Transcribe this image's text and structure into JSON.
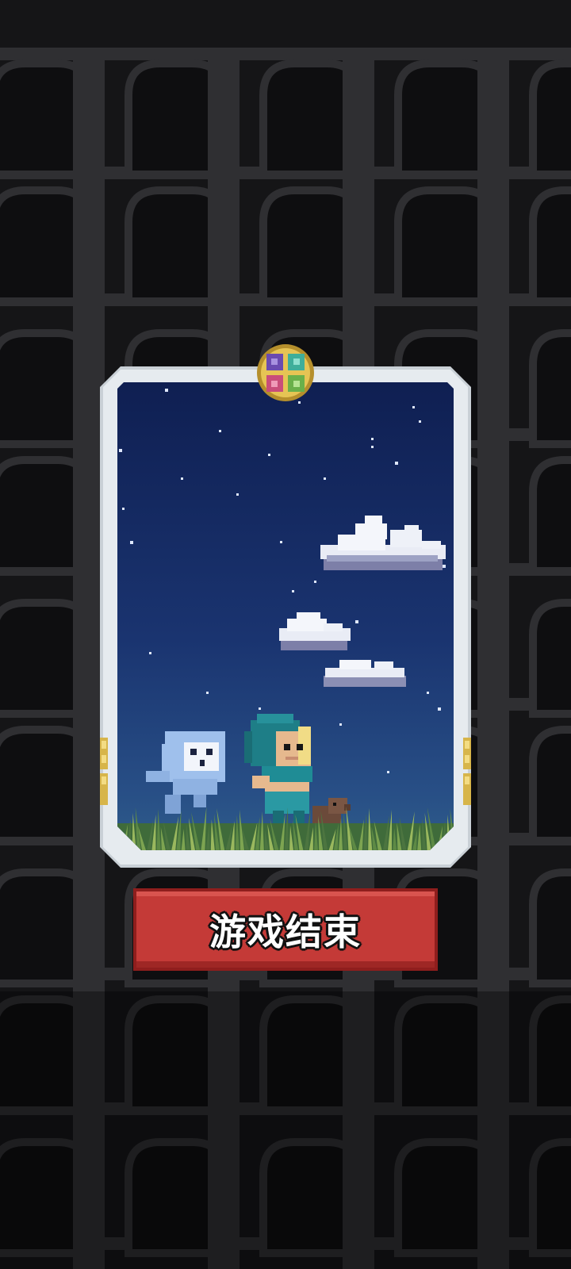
{
  "screen": {
    "background_color": "#1a1a1c",
    "arch_color": "#2f2f32",
    "scene": "night-sky-with-clouds-ghost-hero-and-dog"
  },
  "card": {
    "frame_color": "#c9d0d6",
    "sky_top_color": "#0f1f52",
    "sky_bottom_color": "#2f5d8a",
    "emblem_icon": "four-color-compass-emblem-icon"
  },
  "game_over_button": {
    "label": "游戏结束",
    "color": "#c43a37"
  }
}
